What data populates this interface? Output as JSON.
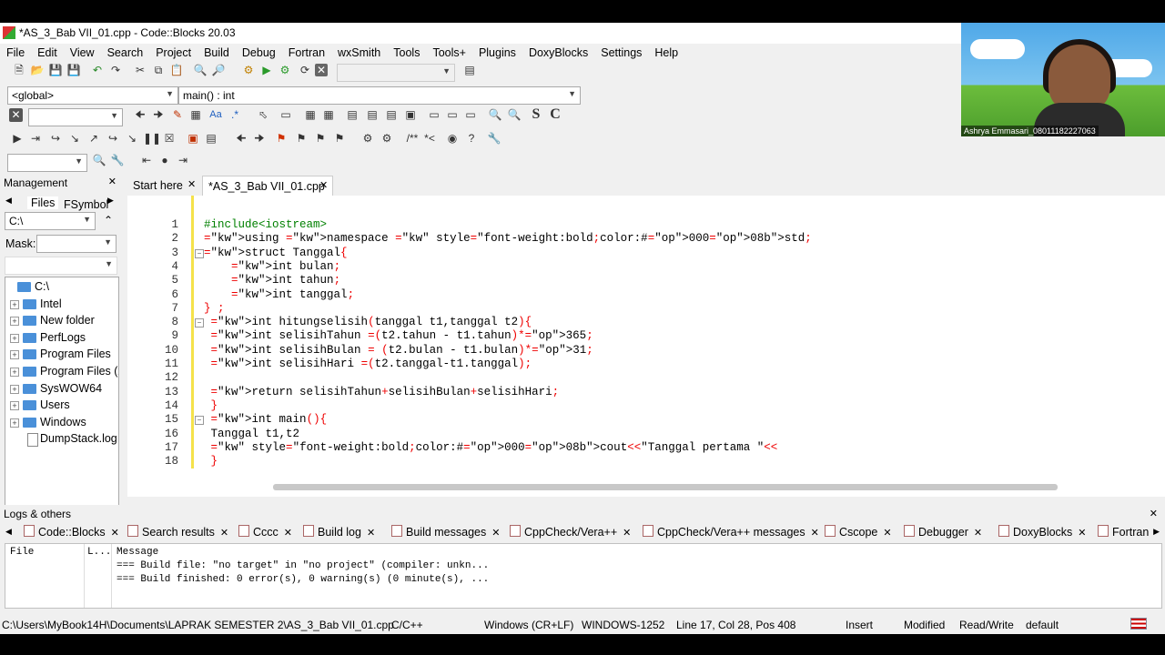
{
  "window": {
    "title": "*AS_3_Bab VII_01.cpp - Code::Blocks 20.03"
  },
  "menu": [
    "File",
    "Edit",
    "View",
    "Search",
    "Project",
    "Build",
    "Debug",
    "Fortran",
    "wxSmith",
    "Tools",
    "Tools+",
    "Plugins",
    "DoxyBlocks",
    "Settings",
    "Help"
  ],
  "scope": {
    "global": "<global>",
    "function": "main() : int"
  },
  "video": {
    "participant": "Ashrya Emmasari_08011182227063"
  },
  "management": {
    "title": "Management",
    "tabs": [
      "Files",
      "FSymbol"
    ],
    "path": "C:\\",
    "mask_label": "Mask:",
    "tree": [
      {
        "label": "C:\\",
        "root": true
      },
      {
        "label": "Intel"
      },
      {
        "label": "New folder"
      },
      {
        "label": "PerfLogs"
      },
      {
        "label": "Program Files"
      },
      {
        "label": "Program Files (x"
      },
      {
        "label": "SysWOW64"
      },
      {
        "label": "Users"
      },
      {
        "label": "Windows"
      },
      {
        "label": "DumpStack.log",
        "file": true
      }
    ]
  },
  "editor": {
    "tabs": [
      {
        "label": "Start here",
        "active": false
      },
      {
        "label": "*AS_3_Bab VII_01.cpp",
        "active": true
      }
    ],
    "line_numbers": [
      "1",
      "2",
      "3",
      "4",
      "5",
      "6",
      "7",
      "8",
      "9",
      "10",
      "11",
      "12",
      "13",
      "14",
      "15",
      "16",
      "17",
      "18"
    ],
    "lines": [
      "#include<iostream>",
      "using namespace std;",
      "struct Tanggal{",
      "    int bulan;",
      "    int tahun;",
      "    int tanggal;",
      "} ;",
      " int hitungselisih(tanggal t1,tanggal t2){",
      " int selisihTahun =(t2.tahun - t1.tahun)*365;",
      " int selisihBulan = (t2.bulan - t1.bulan)*31;",
      " int selisihHari =(t2.tanggal-t1.tanggal);",
      "",
      " return selisihTahun+selisihBulan+selisihHari;",
      " }",
      " int main(){",
      " Tanggal t1,t2",
      " cout<<\"Tanggal pertama \"<<",
      " }"
    ]
  },
  "logs": {
    "title": "Logs & others",
    "tabs": [
      "Code::Blocks",
      "Search results",
      "Cccc",
      "Build log",
      "Build messages",
      "CppCheck/Vera++",
      "CppCheck/Vera++ messages",
      "Cscope",
      "Debugger",
      "DoxyBlocks",
      "Fortran"
    ],
    "columns": [
      "File",
      "L...",
      "Message"
    ],
    "rows": [
      "=== Build file: \"no target\" in \"no project\" (compiler: unkn...",
      "=== Build finished: 0 error(s), 0 warning(s) (0 minute(s), ..."
    ]
  },
  "status": {
    "path": "C:\\Users\\MyBook14H\\Documents\\LAPRAK SEMESTER 2\\AS_3_Bab VII_01.cpp",
    "lang": "C/C++",
    "eol": "Windows (CR+LF)",
    "encoding": "WINDOWS-1252",
    "position": "Line 17, Col 28, Pos 408",
    "mode": "Insert",
    "modified": "Modified",
    "access": "Read/Write",
    "profile": "default"
  }
}
